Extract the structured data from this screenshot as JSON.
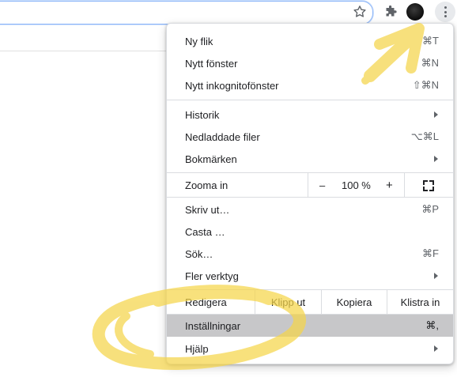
{
  "toolbar": {
    "icons": [
      "star-icon",
      "puzzle-icon",
      "avatar",
      "kebab-menu-icon"
    ]
  },
  "menu": {
    "group1": [
      {
        "label": "Ny flik",
        "shortcut": "⌘T"
      },
      {
        "label": "Nytt fönster",
        "shortcut": "⌘N"
      },
      {
        "label": "Nytt inkognitofönster",
        "shortcut": "⇧⌘N"
      }
    ],
    "group2": [
      {
        "label": "Historik",
        "submenu": true
      },
      {
        "label": "Nedladdade filer",
        "shortcut": "⌥⌘L"
      },
      {
        "label": "Bokmärken",
        "submenu": true
      }
    ],
    "zoom": {
      "label": "Zooma in",
      "minus": "–",
      "value": "100 %",
      "plus": "+"
    },
    "group3": [
      {
        "label": "Skriv ut…",
        "shortcut": "⌘P"
      },
      {
        "label": "Casta …"
      },
      {
        "label": "Sök…",
        "shortcut": "⌘F"
      },
      {
        "label": "Fler verktyg",
        "submenu": true
      }
    ],
    "edit": {
      "label": "Redigera",
      "cut": "Klipp ut",
      "copy": "Kopiera",
      "paste": "Klistra in"
    },
    "group4": [
      {
        "label": "Inställningar",
        "shortcut": "⌘,",
        "highlighted": true
      },
      {
        "label": "Hjälp",
        "submenu": true
      }
    ]
  },
  "colors": {
    "highlight": "#c7c7c9",
    "annotation": "#f5d54a"
  }
}
